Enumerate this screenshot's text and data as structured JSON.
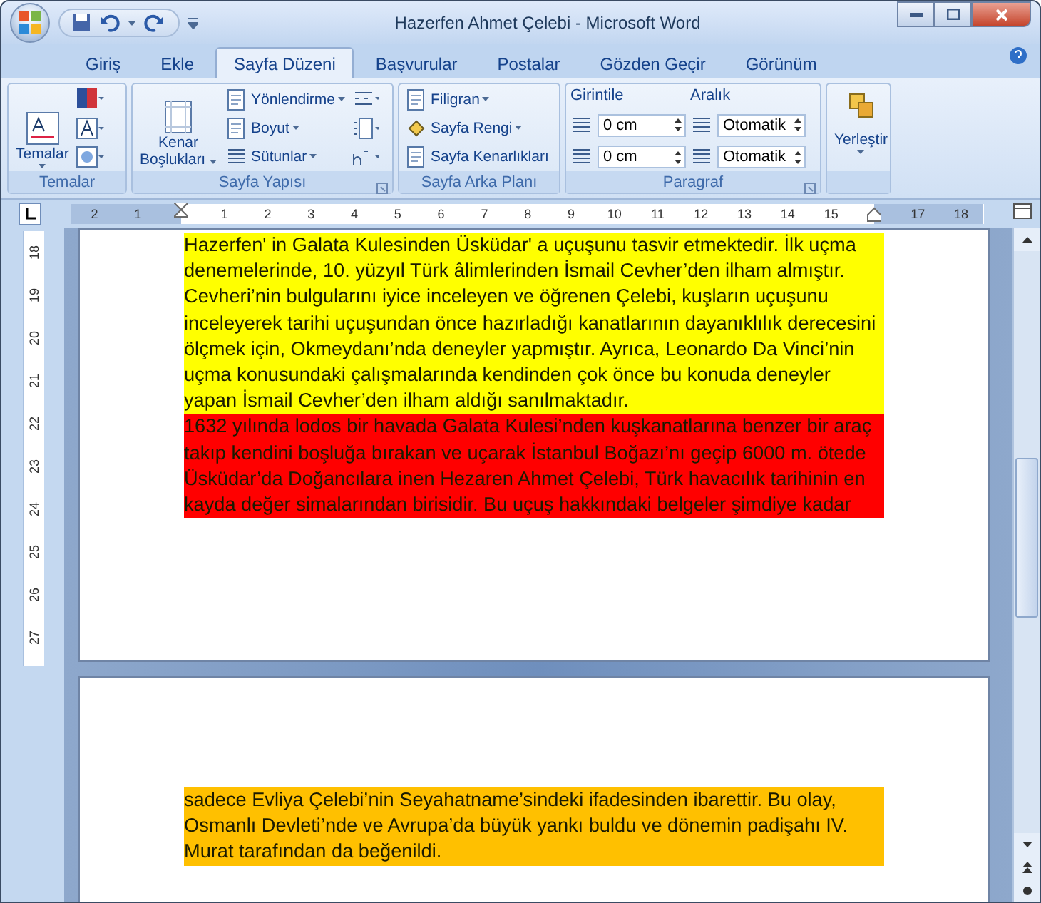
{
  "window": {
    "title": "Hazerfen Ahmet Çelebi - Microsoft Word"
  },
  "tabs": [
    {
      "label": "Giriş",
      "selected": false
    },
    {
      "label": "Ekle",
      "selected": false
    },
    {
      "label": "Sayfa Düzeni",
      "selected": true
    },
    {
      "label": "Başvurular",
      "selected": false
    },
    {
      "label": "Postalar",
      "selected": false
    },
    {
      "label": "Gözden Geçir",
      "selected": false
    },
    {
      "label": "Görünüm",
      "selected": false
    }
  ],
  "ribbon": {
    "groups": [
      {
        "kind": "themes",
        "name": "Temalar",
        "big_button": "Temalar"
      },
      {
        "kind": "page_setup",
        "name": "Sayfa Yapısı",
        "big_button_lines": [
          "Kenar",
          "Boşlukları"
        ],
        "items": [
          "Yönlendirme",
          "Boyut",
          "Sütunlar"
        ]
      },
      {
        "kind": "background",
        "name": "Sayfa Arka Planı",
        "items": [
          "Filigran",
          "Sayfa Rengi",
          "Sayfa Kenarlıkları"
        ]
      },
      {
        "kind": "paragraph",
        "name": "Paragraf",
        "indent_label": "Girintile",
        "indent_values": [
          "0 cm",
          "0 cm"
        ],
        "spacing_label": "Aralık",
        "spacing_values": [
          "Otomatik",
          "Otomatik"
        ]
      },
      {
        "kind": "arrange",
        "big_button": "Yerleştir"
      }
    ]
  },
  "ruler": {
    "left_margin_labels": [
      "2",
      "1"
    ],
    "text_labels": [
      "1",
      "2",
      "3",
      "4",
      "5",
      "6",
      "7",
      "8",
      "9",
      "10",
      "11",
      "12",
      "13",
      "14",
      "15"
    ],
    "right_margin_labels": [
      "17",
      "18"
    ],
    "vertical_labels": [
      "18",
      "19",
      "20",
      "21",
      "22",
      "23",
      "24",
      "25",
      "26",
      "27"
    ]
  },
  "pages": [
    {
      "paragraphs": [
        {
          "text": "Hazerfen' in Galata Kulesinden Üsküdar' a uçuşunu tasvir etmektedir. İlk uçma denemelerinde, 10. yüzyıl Türk âlimlerinden İsmail Cevher’den ilham almıştır. Cevheri’nin bulgularını iyice inceleyen ve öğrenen Çelebi, kuşların uçuşunu inceleyerek tarihi uçuşundan önce hazırladığı kanatlarının dayanıklılık derecesini ölçmek için, Okmeydanı’nda deneyler yapmıştır. Ayrıca, Leonardo Da Vinci’nin uçma konusundaki çalışmalarında kendinden çok önce bu konuda deneyler yapan İsmail Cevher’den ilham aldığı sanılmaktadır.",
          "color": "#ffff00"
        },
        {
          "text": "1632 yılında lodos bir havada Galata Kulesi’nden kuşkanatlarına benzer bir araç takıp kendini boşluğa bırakan ve uçarak İstanbul Boğazı’nı geçip 6000 m. ötede Üsküdar’da Doğancılara inen Hezaren Ahmet Çelebi, Türk havacılık tarihinin en kayda değer simalarından birisidir. Bu uçuş hakkındaki belgeler şimdiye kadar",
          "color": "#ff0000"
        }
      ]
    },
    {
      "paragraphs": [
        {
          "text": "sadece Evliya Çelebi’nin Seyahatname’sindeki ifadesinden ibarettir. Bu olay, Osmanlı Devleti’nde ve Avrupa’da büyük yankı buldu ve dönemin padişahı IV. Murat tarafından da beğenildi.",
          "color": "#ffc000"
        }
      ]
    }
  ]
}
